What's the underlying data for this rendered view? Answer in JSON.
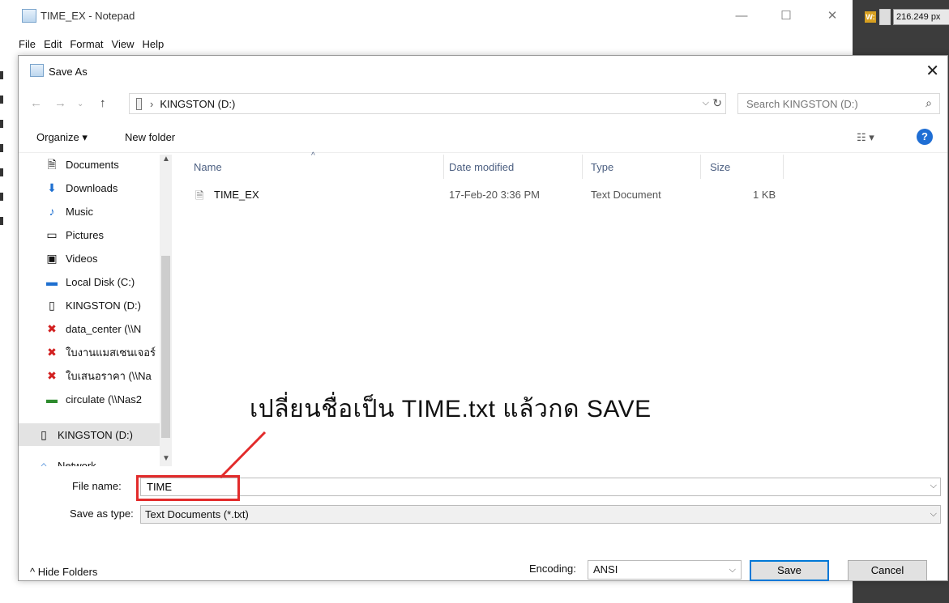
{
  "notepad": {
    "title": "TIME_EX - Notepad",
    "menu": [
      "File",
      "Edit",
      "Format",
      "View",
      "Help"
    ],
    "min_glyph": "—",
    "max_glyph": "☐",
    "close_glyph": "✕"
  },
  "side_panel": {
    "w_label": "W:",
    "w_value": "216.249 px"
  },
  "dialog": {
    "title": "Save As",
    "close_glyph": "✕",
    "path": "KINGSTON (D:)",
    "search_placeholder": "Search KINGSTON (D:)",
    "organize_label": "Organize ▾",
    "new_folder_label": "New folder",
    "nav_items": [
      {
        "label": "Documents",
        "icon": "documents-icon"
      },
      {
        "label": "Downloads",
        "icon": "downloads-icon"
      },
      {
        "label": "Music",
        "icon": "music-icon"
      },
      {
        "label": "Pictures",
        "icon": "pictures-icon"
      },
      {
        "label": "Videos",
        "icon": "videos-icon"
      },
      {
        "label": "Local Disk (C:)",
        "icon": "local-disk-icon"
      },
      {
        "label": "KINGSTON (D:)",
        "icon": "usb-drive-icon"
      },
      {
        "label": "data_center (\\\\N",
        "icon": "network-drive-disconnected-icon"
      },
      {
        "label": "ใบงานแมสเซนเจอร์",
        "icon": "network-drive-disconnected-icon"
      },
      {
        "label": "ใบเสนอราคา (\\\\Na",
        "icon": "network-drive-disconnected-icon"
      },
      {
        "label": "circulate (\\\\Nas2",
        "icon": "network-drive-icon"
      },
      {
        "label": "KINGSTON (D:)",
        "icon": "usb-drive-icon",
        "selected": true
      },
      {
        "label": "Network",
        "icon": "network-icon"
      }
    ],
    "columns": {
      "name": "Name",
      "date": "Date modified",
      "type": "Type",
      "size": "Size"
    },
    "files": [
      {
        "name": "TIME_EX",
        "date": "17-Feb-20 3:36 PM",
        "type": "Text Document",
        "size": "1 KB"
      }
    ],
    "file_name_label": "File name:",
    "file_name_value": "TIME",
    "save_type_label": "Save as type:",
    "save_type_value": "Text Documents (*.txt)",
    "hide_folders_label": "^ Hide Folders",
    "encoding_label": "Encoding:",
    "encoding_value": "ANSI",
    "save_label": "Save",
    "cancel_label": "Cancel"
  },
  "annotation": {
    "text": "เปลี่ยนชื่อเป็น TIME.txt  แล้วกด SAVE",
    "color": "#e22b2b"
  }
}
